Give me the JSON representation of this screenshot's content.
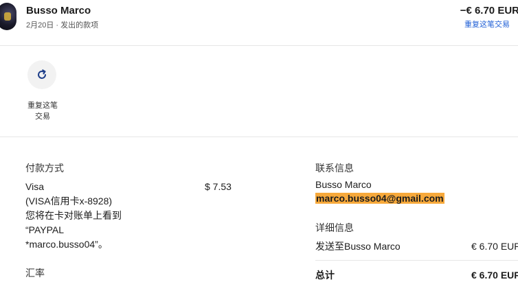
{
  "header": {
    "name": "Busso Marco",
    "meta": "2月20日 · 发出的款项",
    "amount": "−€ 6.70 EUR",
    "repeat_link": "重复这笔交易"
  },
  "actions": {
    "repeat_label_line1": "重复这笔",
    "repeat_label_line2": "交易"
  },
  "payment": {
    "title": "付款方式",
    "method": "Visa",
    "card": "(VISA信用卡x-8928)",
    "statement_line1": "您将在卡对账单上看到",
    "statement_line2": "“PAYPAL",
    "statement_line3": "*marco.busso04”。",
    "amount": "$ 7.53",
    "exchange_title": "汇率"
  },
  "contact": {
    "title": "联系信息",
    "name": "Busso Marco",
    "email": "marco.busso04@gmail.com"
  },
  "details": {
    "title": "详细信息",
    "sent_to_label": "发送至Busso Marco",
    "sent_amount": "€ 6.70 EUR",
    "total_label": "总计",
    "total_amount": "€ 6.70 EUR"
  },
  "colors": {
    "link": "#1f5fd6",
    "highlight": "#f7a93b"
  },
  "icons": {
    "repeat": "refresh-icon"
  }
}
